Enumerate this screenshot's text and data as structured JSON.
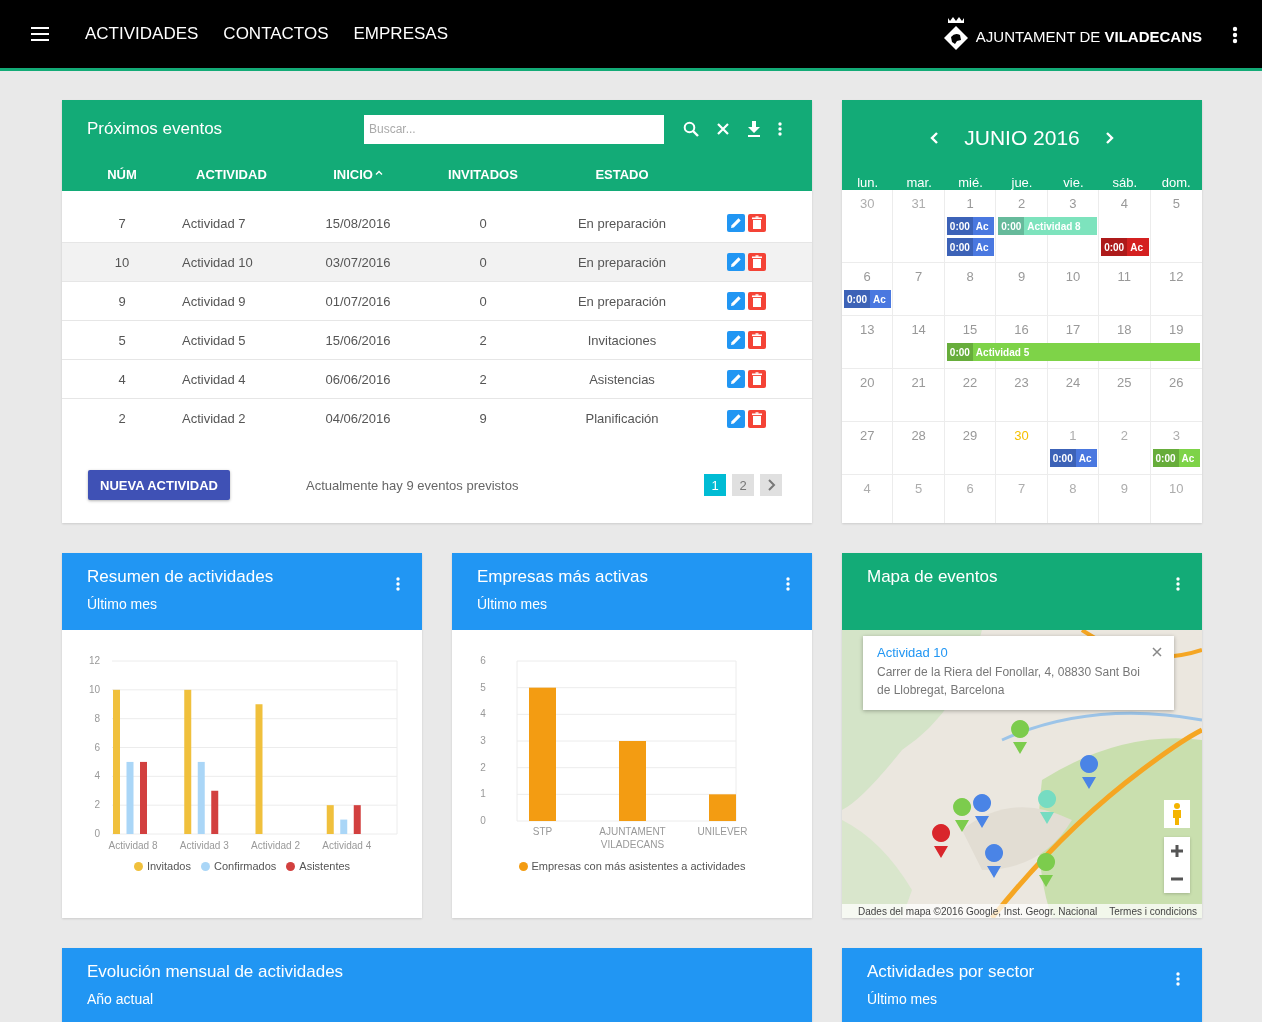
{
  "header": {
    "nav": [
      {
        "label": "ACTIVIDADES"
      },
      {
        "label": "CONTACTOS"
      },
      {
        "label": "EMPRESAS"
      }
    ],
    "brand": "AJUNTAMENT DE **VILADECANS**"
  },
  "events": {
    "title": "Próximos eventos",
    "search": {
      "placeholder": "Buscar..."
    },
    "columns": [
      {
        "label": "NÚM",
        "sorted": false
      },
      {
        "label": "ACTIVIDAD",
        "sorted": false
      },
      {
        "label": "INICIO",
        "sorted": true
      },
      {
        "label": "INVITADOS",
        "sorted": false
      },
      {
        "label": "ESTADO",
        "sorted": false
      }
    ],
    "rows": [
      {
        "cells": [
          "7",
          "Actividad 7",
          "15/08/2016",
          "0",
          "En preparación"
        ],
        "highlighted": false
      },
      {
        "cells": [
          "10",
          "Actividad 10",
          "03/07/2016",
          "0",
          "En preparación"
        ],
        "highlighted": true
      },
      {
        "cells": [
          "9",
          "Actividad 9",
          "01/07/2016",
          "0",
          "En preparación"
        ],
        "highlighted": false
      },
      {
        "cells": [
          "5",
          "Actividad 5",
          "15/06/2016",
          "2",
          "Invitaciones"
        ],
        "highlighted": false
      },
      {
        "cells": [
          "4",
          "Actividad 4",
          "06/06/2016",
          "2",
          "Asistencias"
        ],
        "highlighted": false
      },
      {
        "cells": [
          "2",
          "Actividad 2",
          "04/06/2016",
          "9",
          "Planificación"
        ],
        "highlighted": false
      }
    ],
    "new_button": "NUEVA ACTIVIDAD",
    "summary": "Actualmente hay 9 eventos previstos",
    "pages": [
      {
        "label": "1",
        "selected": true
      },
      {
        "label": "2",
        "selected": false
      }
    ]
  },
  "calendar": {
    "month": "JUNIO 2016",
    "weekdays": [
      "lun.",
      "mar.",
      "mié.",
      "jue.",
      "vie.",
      "sáb.",
      "dom."
    ],
    "weeks": [
      {
        "days": [
          {
            "num": "30",
            "muted": true,
            "today": false
          },
          {
            "num": "31",
            "muted": true,
            "today": false
          },
          {
            "num": "1",
            "muted": false,
            "today": false,
            "events": [
              {
                "kind": "start",
                "time": "0:00",
                "title": "Ac",
                "color": "#4a78e0"
              },
              {
                "kind": "start",
                "time": "0:00",
                "title": "Ac",
                "color": "#4a78e0"
              }
            ]
          },
          {
            "num": "2",
            "muted": false,
            "today": false,
            "events": [
              {
                "kind": "start",
                "time": "0:00",
                "title": "Actividad 8",
                "color": "#7de3bd"
              }
            ]
          },
          {
            "num": "3",
            "muted": false,
            "today": false,
            "events": [
              {
                "kind": "continued"
              }
            ]
          },
          {
            "num": "4",
            "muted": false,
            "today": false,
            "events": [
              {
                "kind": "blank"
              },
              {
                "kind": "start",
                "time": "0:00",
                "title": "Ac",
                "color": "#d42020"
              }
            ]
          },
          {
            "num": "5",
            "muted": false,
            "today": false
          }
        ]
      },
      {
        "days": [
          {
            "num": "6",
            "muted": false,
            "today": false,
            "events": [
              {
                "kind": "start",
                "time": "0:00",
                "title": "Ac",
                "color": "#4a78e0"
              }
            ]
          },
          {
            "num": "7",
            "muted": false,
            "today": false
          },
          {
            "num": "8",
            "muted": false,
            "today": false
          },
          {
            "num": "9",
            "muted": false,
            "today": false
          },
          {
            "num": "10",
            "muted": false,
            "today": false
          },
          {
            "num": "11",
            "muted": false,
            "today": false
          },
          {
            "num": "12",
            "muted": false,
            "today": false
          }
        ]
      },
      {
        "days": [
          {
            "num": "13",
            "muted": false,
            "today": false
          },
          {
            "num": "14",
            "muted": false,
            "today": false
          },
          {
            "num": "15",
            "muted": false,
            "today": false,
            "events": [
              {
                "kind": "start",
                "time": "0:00",
                "title": "Actividad 5",
                "color": "#7ed348"
              }
            ]
          },
          {
            "num": "16",
            "muted": false,
            "today": false,
            "events": [
              {
                "kind": "continued"
              }
            ]
          },
          {
            "num": "17",
            "muted": false,
            "today": false,
            "events": [
              {
                "kind": "continued"
              }
            ]
          },
          {
            "num": "18",
            "muted": false,
            "today": false,
            "events": [
              {
                "kind": "continued"
              }
            ]
          },
          {
            "num": "19",
            "muted": false,
            "today": false,
            "events": [
              {
                "kind": "continued"
              }
            ]
          }
        ]
      },
      {
        "days": [
          {
            "num": "20",
            "muted": false,
            "today": false
          },
          {
            "num": "21",
            "muted": false,
            "today": false
          },
          {
            "num": "22",
            "muted": false,
            "today": false
          },
          {
            "num": "23",
            "muted": false,
            "today": false
          },
          {
            "num": "24",
            "muted": false,
            "today": false
          },
          {
            "num": "25",
            "muted": false,
            "today": false
          },
          {
            "num": "26",
            "muted": false,
            "today": false
          }
        ]
      },
      {
        "days": [
          {
            "num": "27",
            "muted": false,
            "today": false
          },
          {
            "num": "28",
            "muted": false,
            "today": false
          },
          {
            "num": "29",
            "muted": false,
            "today": false
          },
          {
            "num": "30",
            "muted": false,
            "today": true
          },
          {
            "num": "1",
            "muted": true,
            "today": false,
            "events": [
              {
                "kind": "start",
                "time": "0:00",
                "title": "Ac",
                "color": "#4a78e0"
              }
            ]
          },
          {
            "num": "2",
            "muted": true,
            "today": false
          },
          {
            "num": "3",
            "muted": true,
            "today": false,
            "events": [
              {
                "kind": "start",
                "time": "0:00",
                "title": "Ac",
                "color": "#7ed348"
              }
            ]
          }
        ]
      },
      {
        "days": [
          {
            "num": "4",
            "muted": true,
            "today": false
          },
          {
            "num": "5",
            "muted": true,
            "today": false
          },
          {
            "num": "6",
            "muted": true,
            "today": false
          },
          {
            "num": "7",
            "muted": true,
            "today": false
          },
          {
            "num": "8",
            "muted": true,
            "today": false
          },
          {
            "num": "9",
            "muted": true,
            "today": false
          },
          {
            "num": "10",
            "muted": true,
            "today": false
          }
        ]
      }
    ]
  },
  "activity_summary": {
    "title": "Resumen de actividades",
    "subtitle": "Último mes",
    "chart_data": {
      "type": "bar",
      "grid": true,
      "legend": "bottom",
      "categories": [
        "Actividad 8",
        "Actividad 3",
        "Actividad 2",
        "Actividad 4"
      ],
      "ylim": [
        0,
        12
      ],
      "yticks": [
        0,
        2,
        4,
        6,
        8,
        10,
        12
      ],
      "series": [
        {
          "name": "Invitados",
          "color": "#f0c03c",
          "values": [
            10,
            10,
            9,
            2
          ]
        },
        {
          "name": "Confirmados",
          "color": "#aad6f7",
          "values": [
            5,
            5,
            0,
            1
          ]
        },
        {
          "name": "Asistentes",
          "color": "#d2403f",
          "values": [
            5,
            3,
            0,
            2
          ]
        }
      ]
    }
  },
  "top_companies": {
    "title": "Empresas más activas",
    "subtitle": "Último mes",
    "chart_data": {
      "type": "bar",
      "grid": true,
      "legend": "bottom",
      "categories": [
        "STP",
        "AJUNTAMENT VILADECANS",
        "UNILEVER"
      ],
      "ylim": [
        0,
        6
      ],
      "yticks": [
        0,
        1,
        2,
        3,
        4,
        5,
        6
      ],
      "series": [
        {
          "name": "Empresas con más asistentes a actividades",
          "color": "#f39c12",
          "values": [
            5,
            3,
            1
          ]
        }
      ]
    }
  },
  "event_map": {
    "title": "Mapa de eventos",
    "popup": {
      "title": "Actividad 10",
      "address": "Carrer de la Riera del Fonollar, 4, 08830 Sant Boi de Llobregat, Barcelona"
    },
    "attribution": "Dades del mapa ©2016 Google, Inst. Geogr. Nacional",
    "terms": "Termes i condicions"
  },
  "monthly_evolution": {
    "title": "Evolución mensual de actividades",
    "subtitle": "Año actual"
  },
  "sector_activities": {
    "title": "Actividades por sector",
    "subtitle": "Último mes"
  }
}
